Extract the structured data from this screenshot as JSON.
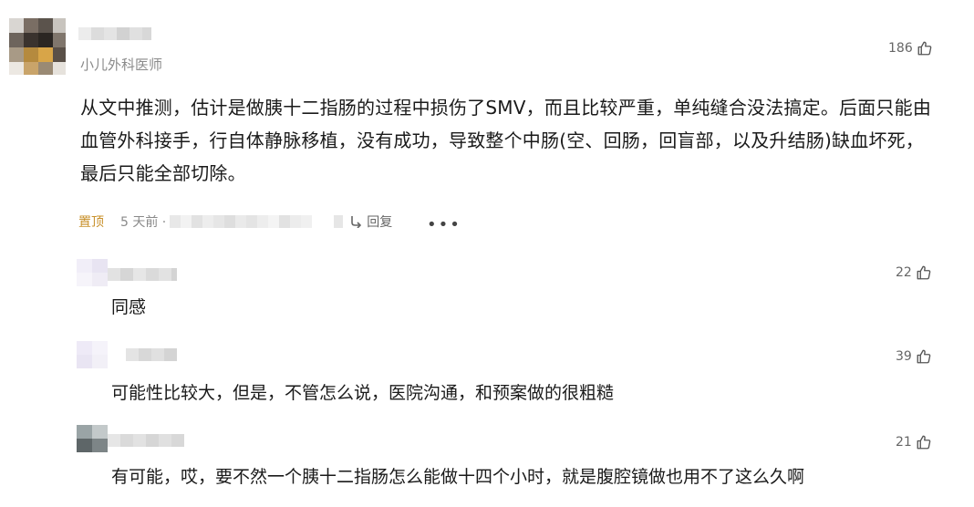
{
  "main_comment": {
    "subtitle": "小儿外科医师",
    "like_count": "186",
    "text": "从文中推测，估计是做胰十二指肠的过程中损伤了SMV，而且比较严重，单纯缝合没法搞定。后面只能由血管外科接手，行自体静脉移植，没有成功，导致整个中肠(空、回肠，回盲部，以及升结肠)缺血坏死，最后只能全部切除。",
    "pin_label": "置顶",
    "time": "5 天前 ·",
    "reply_label": "回复",
    "more_label": "•••"
  },
  "replies": [
    {
      "text": "同感",
      "like_count": "22"
    },
    {
      "text": "可能性比较大，但是，不管怎么说，医院沟通，和预案做的很粗糙",
      "like_count": "39"
    },
    {
      "text": "有可能，哎，要不然一个胰十二指肠怎么能做十四个小时，就是腹腔镜做也用不了这么久啊",
      "like_count": "21"
    }
  ],
  "colors": {
    "pin": "#c8902a",
    "meta": "#8a8a8a",
    "text": "#1a1a1a"
  },
  "icons": {
    "like": "thumbs-up-icon",
    "reply": "reply-icon",
    "more": "more-dots-icon"
  }
}
